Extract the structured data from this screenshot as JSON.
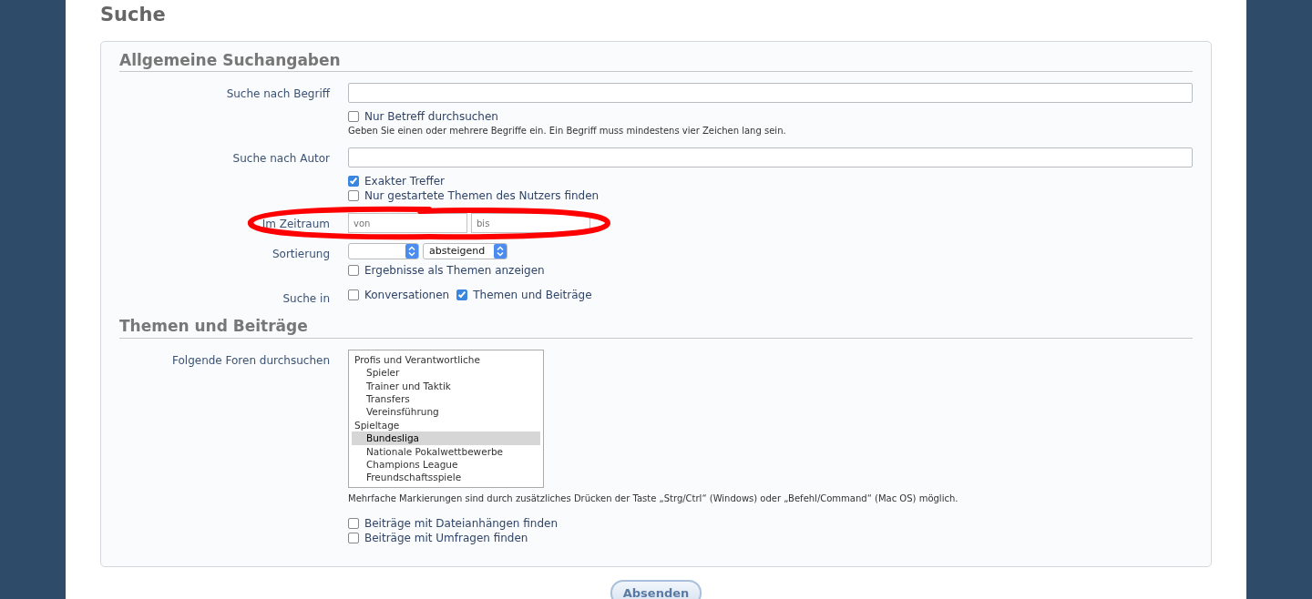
{
  "title": "Suche",
  "sections": [
    {
      "heading": "Allgemeine Suchangaben",
      "rows": [
        {
          "label": "Suche nach Begriff",
          "controls": [
            {
              "kind": "text"
            },
            {
              "kind": "checkbox",
              "label": "Nur Betreff durchsuchen",
              "checked": false
            },
            {
              "kind": "hint",
              "text": "Geben Sie einen oder mehrere Begriffe ein. Ein Begriff muss mindestens vier Zeichen lang sein."
            }
          ]
        },
        {
          "label": "Suche nach Autor",
          "controls": [
            {
              "kind": "text"
            },
            {
              "kind": "checkbox",
              "label": "Exakter Treffer",
              "checked": true
            },
            {
              "kind": "checkbox",
              "label": "Nur gestartete Themen des Nutzers finden",
              "checked": false
            }
          ]
        },
        {
          "label": "Im Zeitraum",
          "controls": [
            {
              "kind": "range",
              "fields": [
                {
                  "placeholder": "von"
                },
                {
                  "placeholder": "bis"
                }
              ]
            }
          ]
        },
        {
          "label": "Sortierung",
          "controls": [
            {
              "kind": "selects",
              "fields": [
                {
                  "kind": "select"
                },
                {
                  "kind": "select",
                  "value": "absteigend"
                }
              ]
            },
            {
              "kind": "checkbox",
              "label": "Ergebnisse als Themen anzeigen",
              "checked": false
            }
          ]
        },
        {
          "label": "Suche in",
          "controls": [
            {
              "kind": "checkgroup",
              "items": [
                {
                  "label": "Konversationen",
                  "checked": false
                },
                {
                  "label": "Themen und Beiträge",
                  "checked": true
                }
              ]
            }
          ]
        }
      ]
    },
    {
      "heading": "Themen und Beiträge",
      "rows": [
        {
          "label": "Folgende Foren durchsuchen",
          "controls": [
            {
              "kind": "listbox",
              "items": [
                {
                  "label": "Profis und Verantwortliche",
                  "selected": false,
                  "children": [
                    {
                      "label": "Spieler",
                      "selected": false
                    },
                    {
                      "label": "Trainer und Taktik",
                      "selected": false
                    },
                    {
                      "label": "Transfers",
                      "selected": false
                    },
                    {
                      "label": "Vereinsführung",
                      "selected": false
                    }
                  ]
                },
                {
                  "label": "Spieltage",
                  "selected": false,
                  "children": [
                    {
                      "label": "Bundesliga",
                      "selected": true
                    },
                    {
                      "label": "Nationale Pokalwettbewerbe",
                      "selected": false
                    },
                    {
                      "label": "Champions League",
                      "selected": false
                    },
                    {
                      "label": "Freundschaftsspiele",
                      "selected": false
                    }
                  ]
                }
              ]
            },
            {
              "kind": "hint",
              "text": "Mehrfache Markierungen sind durch zusätzliches Drücken der Taste „Strg/Ctrl“ (Windows) oder „Befehl/Command“ (Mac OS) möglich."
            },
            {
              "kind": "gap"
            },
            {
              "kind": "checkbox",
              "label": "Beiträge mit Dateianhängen finden",
              "checked": false
            },
            {
              "kind": "checkbox",
              "label": "Beiträge mit Umfragen finden",
              "checked": false
            }
          ]
        }
      ]
    }
  ],
  "submit": "Absenden"
}
